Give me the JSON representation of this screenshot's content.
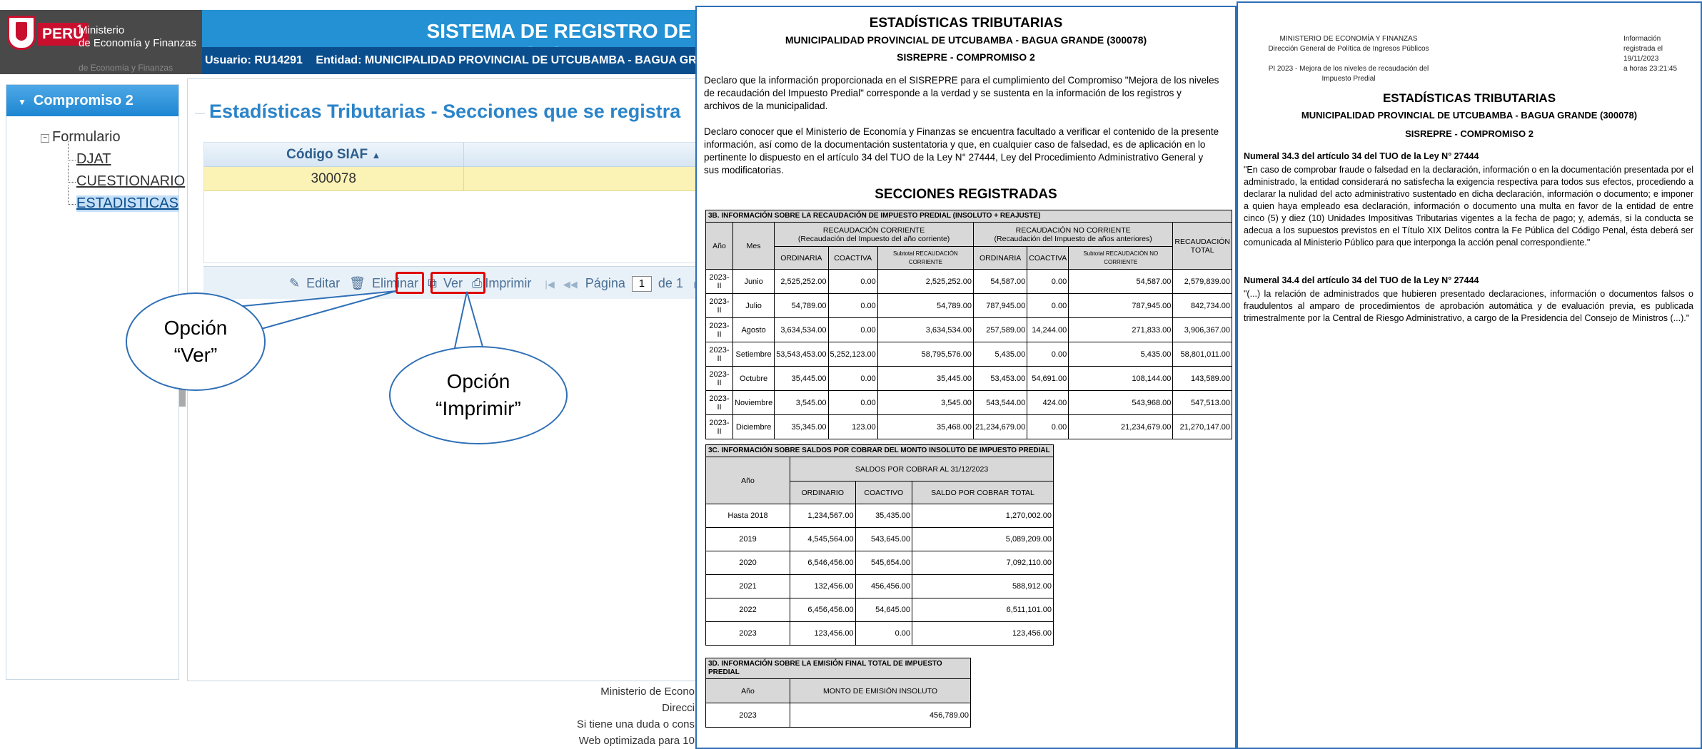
{
  "app": {
    "brand_country": "PERÚ",
    "brand_ministry": "Ministerio\nde Economía y Finanzas",
    "brand_ministry_faded": "de Economía y Finanzas",
    "system_title": "SISTEMA DE REGISTRO DE IMPUESTO PREDIAL",
    "user_label": "Usuario: RU14291",
    "entity_label": "Entidad: MUNICIPALIDAD PROVINCIAL DE UTCUBAMBA - BAGUA GRANDE"
  },
  "sidebar": {
    "header": "Compromiso 2",
    "root": "Formulario",
    "items": [
      {
        "label": "DJAT",
        "selected": false
      },
      {
        "label": "CUESTIONARIO",
        "selected": false
      },
      {
        "label": "ESTADISTICAS",
        "selected": true
      }
    ]
  },
  "main": {
    "heading": "Estadísticas Tributarias - Secciones que se registra",
    "grid_header": "Código SIAF",
    "grid_value": "300078",
    "pager": {
      "edit": "Editar",
      "delete": "Eliminar",
      "view": "Ver",
      "print": "Imprimir",
      "page_label": "Página",
      "page_value": "1",
      "of_label": "de 1"
    }
  },
  "footer": {
    "lines": [
      "Ministerio de Econo",
      "Direcci",
      "Si tiene una duda o cons",
      "Web optimizada para 10"
    ]
  },
  "callouts": {
    "ver": [
      "Opción",
      "“Ver”"
    ],
    "imprimir": [
      "Opción",
      "“Imprimir”"
    ]
  },
  "doc1": {
    "title": "ESTADÍSTICAS TRIBUTARIAS",
    "subtitle": "MUNICIPALIDAD PROVINCIAL DE UTCUBAMBA - BAGUA GRANDE (300078)",
    "subtitle2": "SISREPRE - COMPROMISO  2",
    "para1": "Declaro que la información proporcionada en el SISREPRE para el cumplimiento del Compromiso \"Mejora de los niveles de recaudación del Impuesto Predial\" corresponde a la verdad y se sustenta en la información de los registros y archivos de la municipalidad.",
    "para2": "Declaro conocer que el Ministerio de Economía y Finanzas se encuentra facultado a verificar el contenido de la presente información, así como de la documentación sustentatoria y que, en cualquier caso de falsedad, es de aplicación en lo pertinente lo dispuesto en el artículo 34 del TUO de la Ley N° 27444, Ley del Procedimiento Administrativo General y sus modificatorias.",
    "sections_title": "SECCIONES REGISTRADAS",
    "t3b": {
      "caption": "3B. INFORMACIÓN SOBRE LA RECAUDACIÓN DE IMPUESTO PREDIAL (INSOLUTO + REAJUSTE)",
      "h_year": "Año",
      "h_month": "Mes",
      "h_corr": "RECAUDACIÓN CORRIENTE\n(Recaudación del Impuesto del año corriente)",
      "h_nocorr": "RECAUDACIÓN NO CORRIENTE\n(Recaudación del Impuesto de años anteriores)",
      "h_total": "RECAUDACIÓN\nTOTAL",
      "h_ord": "ORDINARIA",
      "h_coa": "COACTIVA",
      "h_sub1": "Subtotal RECAUDACIÓN CORRIENTE",
      "h_sub2": "Subtotal RECAUDACIÓN NO CORRIENTE",
      "rows": [
        [
          "2023-II",
          "Junio",
          "2,525,252.00",
          "0.00",
          "2,525,252.00",
          "54,587.00",
          "0.00",
          "54,587.00",
          "2,579,839.00"
        ],
        [
          "2023-II",
          "Julio",
          "54,789.00",
          "0.00",
          "54,789.00",
          "787,945.00",
          "0.00",
          "787,945.00",
          "842,734.00"
        ],
        [
          "2023-II",
          "Agosto",
          "3,634,534.00",
          "0.00",
          "3,634,534.00",
          "257,589.00",
          "14,244.00",
          "271,833.00",
          "3,906,367.00"
        ],
        [
          "2023-II",
          "Setiembre",
          "53,543,453.00",
          "5,252,123.00",
          "58,795,576.00",
          "5,435.00",
          "0.00",
          "5,435.00",
          "58,801,011.00"
        ],
        [
          "2023-II",
          "Octubre",
          "35,445.00",
          "0.00",
          "35,445.00",
          "53,453.00",
          "54,691.00",
          "108,144.00",
          "143,589.00"
        ],
        [
          "2023-II",
          "Noviembre",
          "3,545.00",
          "0.00",
          "3,545.00",
          "543,544.00",
          "424.00",
          "543,968.00",
          "547,513.00"
        ],
        [
          "2023-II",
          "Diciembre",
          "35,345.00",
          "123.00",
          "35,468.00",
          "21,234,679.00",
          "0.00",
          "21,234,679.00",
          "21,270,147.00"
        ]
      ]
    },
    "t3c": {
      "caption": "3C. INFORMACIÓN SOBRE SALDOS POR COBRAR DEL MONTO INSOLUTO DE IMPUESTO PREDIAL",
      "h_year": "Año",
      "h_group": "SALDOS POR COBRAR AL 31/12/2023",
      "h_ord": "ORDINARIO",
      "h_coa": "COACTIVO",
      "h_sal": "SALDO POR COBRAR TOTAL",
      "rows": [
        [
          "Hasta 2018",
          "1,234,567.00",
          "35,435.00",
          "1,270,002.00"
        ],
        [
          "2019",
          "4,545,564.00",
          "543,645.00",
          "5,089,209.00"
        ],
        [
          "2020",
          "6,546,456.00",
          "545,654.00",
          "7,092,110.00"
        ],
        [
          "2021",
          "132,456.00",
          "456,456.00",
          "588,912.00"
        ],
        [
          "2022",
          "6,456,456.00",
          "54,645.00",
          "6,511,101.00"
        ],
        [
          "2023",
          "123,456.00",
          "0.00",
          "123,456.00"
        ]
      ]
    },
    "t3d": {
      "caption": "3D. INFORMACIÓN SOBRE LA EMISIÓN FINAL TOTAL DE IMPUESTO PREDIAL",
      "h_year": "Año",
      "h_amount": "MONTO DE EMISIÓN INSOLUTO",
      "rows": [
        [
          "2023",
          "456,789.00"
        ]
      ]
    }
  },
  "doc2": {
    "header_left": "MINISTERIO DE ECONOMÍA Y FINANZAS\nDirección General de Política de Ingresos Públicos\n\nPI 2023 - Mejora de los niveles de recaudación del\nImpuesto Predial",
    "header_right": "Información\nregistrada el\n19/11/2023\na horas 23:21:45",
    "title": "ESTADÍSTICAS TRIBUTARIAS",
    "subtitle": "MUNICIPALIDAD PROVINCIAL DE UTCUBAMBA - BAGUA GRANDE (300078)",
    "subtitle2": "SISREPRE - COMPROMISO  2",
    "n1_head": "Numeral 34.3 del artículo 34 del TUO de la Ley N° 27444",
    "n1_text": "\"En caso de comprobar fraude o falsedad en la declaración, información o en la documentación presentada por el administrado, la entidad considerará no satisfecha la exigencia respectiva para todos sus efectos, procediendo a declarar la nulidad del acto administrativo sustentado en dicha declaración, información o documento; e imponer a quien haya empleado esa declaración, información o documento una multa en favor de la entidad de entre cinco (5) y diez (10) Unidades Impositivas Tributarias vigentes a la fecha de pago; y, además, si la conducta se adecua a los supuestos previstos en el Título XIX Delitos contra la Fe Pública del Código Penal, ésta deberá ser comunicada al Ministerio Público para que interponga la acción penal correspondiente.\"",
    "n2_head": "Numeral 34.4 del artículo 34 del TUO de la Ley N° 27444",
    "n2_text": "\"(...) la relación de administrados que hubieren presentado declaraciones, información o documentos falsos o fraudulentos al amparo de procedimientos de aprobación automática y de evaluación previa, es publicada trimestralmente por la Central de Riesgo Administrativo, a cargo de la Presidencia del Consejo de Ministros (...).\""
  }
}
